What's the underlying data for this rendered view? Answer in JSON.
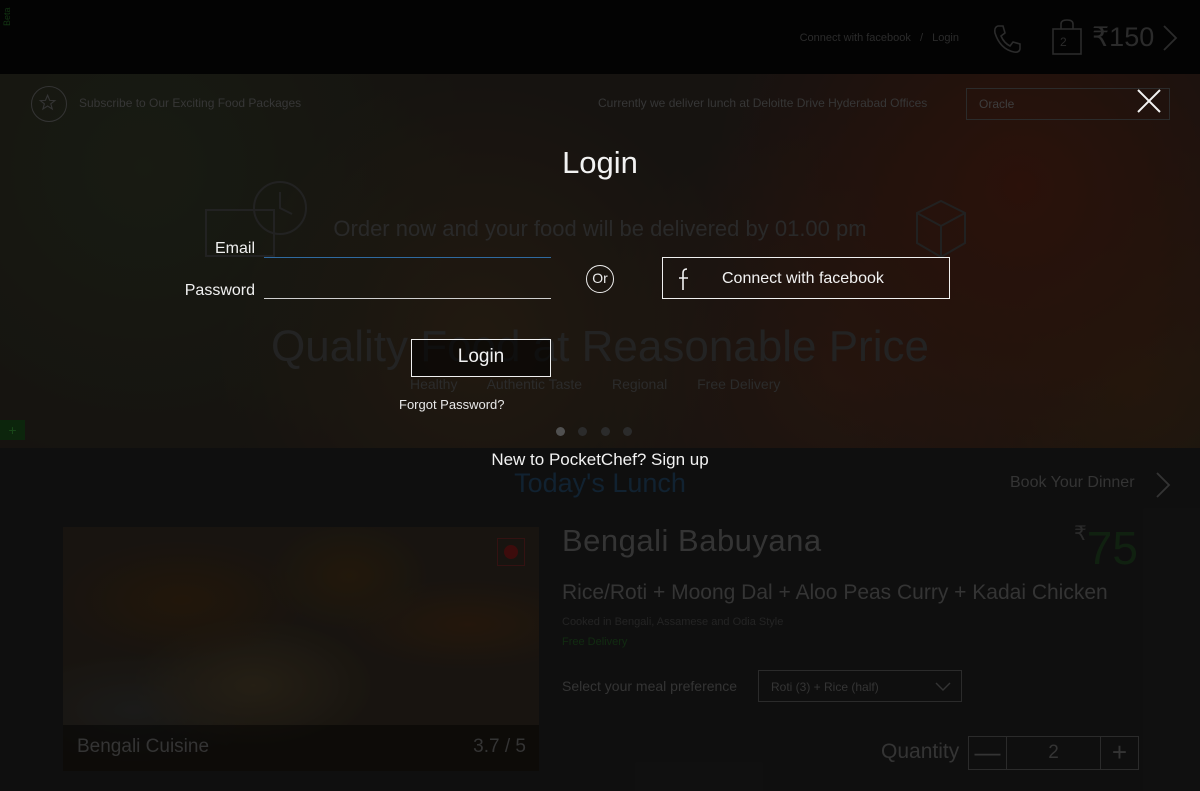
{
  "header": {
    "side_tag": "Beta",
    "connect_facebook": "Connect with facebook",
    "separator": "/",
    "login": "Login",
    "cart_count": "2",
    "cart_amount": "₹150"
  },
  "hero": {
    "subscribe": "Subscribe to Our Exciting Food Packages",
    "delivery_note": "Currently we deliver lunch at Deloitte Drive Hyderabad Offices",
    "location_value": "Oracle",
    "order_now": "Order now and your food will be delivered by 01.00 pm",
    "tagline": "Quality Food at Reasonable Price",
    "features": [
      "Healthy",
      "Authentic Taste",
      "Regional",
      "Free Delivery"
    ],
    "plus_tab": "+"
  },
  "lunch": {
    "section_title": "Today's Lunch",
    "book_dinner": "Book Your Dinner",
    "cuisine": "Bengali Cuisine",
    "rating": "3.7 / 5",
    "meal_name": "Bengali Babuyana",
    "price_currency": "₹",
    "price_amount": "75",
    "items": "Rice/Roti + Moong Dal + Aloo Peas Curry + Kadai Chicken",
    "style": "Cooked in Bengali, Assamese and Odia Style",
    "free_delivery": "Free Delivery",
    "preference_label": "Select your meal preference",
    "preference_value": "Roti (3) + Rice (half)",
    "quantity_label": "Quantity",
    "quantity_minus": "—",
    "quantity_value": "2",
    "quantity_plus": "+"
  },
  "login_modal": {
    "title": "Login",
    "email_label": "Email",
    "email_value": "",
    "password_label": "Password",
    "password_value": "",
    "or_text": "Or",
    "facebook_button": "Connect with facebook",
    "login_button": "Login",
    "forgot_password": "Forgot Password?",
    "signup_prompt": "New to PocketChef? Sign up"
  },
  "colors": {
    "overlay_text": "#f2f2f2",
    "email_focus": "#2f6aa0",
    "accent_green": "#1d3a1d",
    "section_blue": "#1e3b55"
  }
}
